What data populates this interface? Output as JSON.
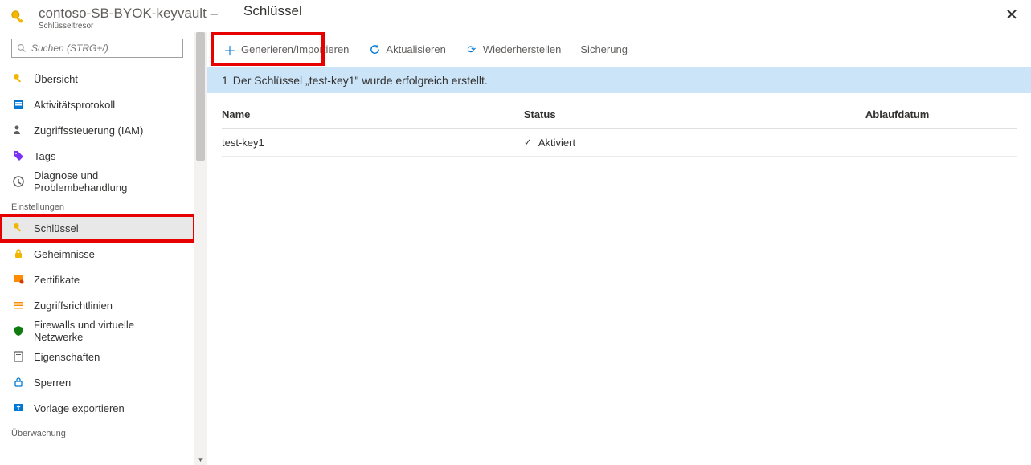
{
  "header": {
    "breadcrumb": "contoso-SB-BYOK-keyvault –",
    "resource_type": "Schlüsseltresor",
    "page_title": "Schlüssel"
  },
  "sidebar": {
    "search_placeholder": "Suchen (STRG+/)",
    "items_top": [
      {
        "label": "Übersicht",
        "icon": "key-icon"
      },
      {
        "label": "Aktivitätsprotokoll",
        "icon": "log-icon"
      },
      {
        "label": "Zugriffssteuerung (IAM)",
        "icon": "iam-icon"
      },
      {
        "label": "Tags",
        "icon": "tag-icon"
      },
      {
        "label": "Diagnose und Problembehandlung",
        "icon": "diagnose-icon"
      }
    ],
    "section_settings": "Einstellungen",
    "items_settings": [
      {
        "label": "Schlüssel",
        "icon": "key-icon",
        "selected": true
      },
      {
        "label": "Geheimnisse",
        "icon": "secret-icon"
      },
      {
        "label": "Zertifikate",
        "icon": "cert-icon"
      },
      {
        "label": "Zugriffsrichtlinien",
        "icon": "policy-icon"
      },
      {
        "label": "Firewalls und virtuelle Netzwerke",
        "icon": "firewall-icon"
      },
      {
        "label": "Eigenschaften",
        "icon": "properties-icon"
      },
      {
        "label": "Sperren",
        "icon": "lock-icon"
      },
      {
        "label": "Vorlage exportieren",
        "icon": "export-icon"
      }
    ],
    "section_monitoring": "Überwachung"
  },
  "toolbar": {
    "generate": "Generieren/Importieren",
    "refresh": "Aktualisieren",
    "restore": "Wiederherstellen",
    "backup": "Sicherung"
  },
  "notification": {
    "count": "1",
    "text": "Der Schlüssel „test-key1\" wurde erfolgreich erstellt."
  },
  "table": {
    "columns": {
      "name": "Name",
      "status": "Status",
      "expiry": "Ablaufdatum"
    },
    "rows": [
      {
        "name": "test-key1",
        "status": "Aktiviert",
        "expiry": ""
      }
    ]
  }
}
